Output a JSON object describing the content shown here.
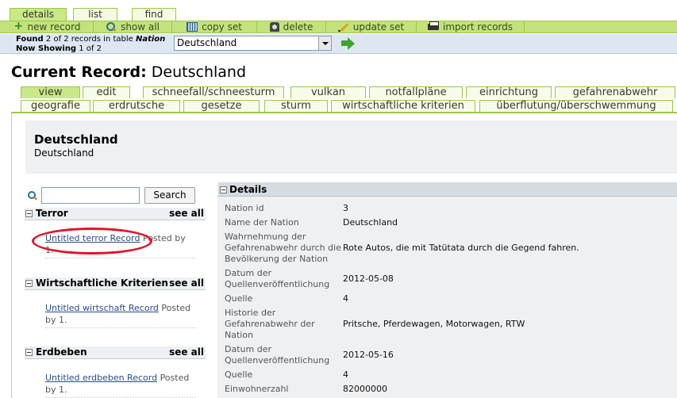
{
  "top_tabs": [
    "details",
    "list",
    "find"
  ],
  "actions": [
    {
      "label": "new record",
      "icon": "plus-icon"
    },
    {
      "label": "show all",
      "icon": "magnifier-icon"
    },
    {
      "label": "copy set",
      "icon": "spreadsheet-icon"
    },
    {
      "label": "delete",
      "icon": "trash-icon"
    },
    {
      "label": "update set",
      "icon": "pencil-icon"
    },
    {
      "label": "import records",
      "icon": "printer-icon"
    }
  ],
  "found": {
    "found_label": "Found",
    "found_count": "2",
    "of_text": "of 2 records in table",
    "table_name": "Nation",
    "now_showing_label": "Now Showing",
    "now_showing_value": "1 of 2"
  },
  "record_select": {
    "value": "Deutschland"
  },
  "heading": {
    "label": "Current Record:",
    "value": "Deutschland"
  },
  "record_tabs_row1": [
    "view",
    "edit",
    "schneefall/schneesturm",
    "vulkan",
    "notfallpläne",
    "einrichtung",
    "gefahrenabwehr"
  ],
  "record_tabs_row2": [
    "geografie",
    "erdrutsche",
    "gesetze",
    "sturm",
    "wirtschaftliche kriterien",
    "überflutung/überschwemmung"
  ],
  "record_header": {
    "title": "Deutschland",
    "subtitle": "Deutschland"
  },
  "search": {
    "button_label": "Search",
    "value": ""
  },
  "sections": [
    {
      "title": "Terror",
      "see_all": "see all",
      "item_link": "Untitled terror Record",
      "item_text_1": "Posted by",
      "item_text_2": "1."
    },
    {
      "title": "Wirtschaftliche Kriterien",
      "see_all": "see all",
      "item_link": "Untitled wirtschaft Record",
      "item_text_1": "Posted",
      "item_text_2": "by 1."
    },
    {
      "title": "Erdbeben",
      "see_all": "see all",
      "item_link": "Untitled erdbeben Record",
      "item_text_1": "Posted",
      "item_text_2": "by 1."
    }
  ],
  "details": {
    "title": "Details",
    "fields": [
      {
        "label": "Nation id",
        "value": "3"
      },
      {
        "label": "Name der Nation",
        "value": "Deutschland"
      },
      {
        "label": "Wahrnehmung der Gefahrenabwehr durch die Bevölkerung der Nation",
        "value": "Rote Autos, die mit Tatütata durch die Gegend fahren."
      },
      {
        "label": "Datum der Quellenveröffentlichung",
        "value": "2012-05-08"
      },
      {
        "label": "Quelle",
        "value": "4"
      },
      {
        "label": "Historie der Gefahrenabwehr der Nation",
        "value": "Pritsche, Pferdewagen, Motorwagen, RTW"
      },
      {
        "label": "Datum der Quellenveröffentlichung",
        "value": "2012-05-16"
      },
      {
        "label": "Quelle",
        "value": "4"
      },
      {
        "label": "Einwohnerzahl",
        "value": "82000000"
      }
    ]
  },
  "colors": {
    "tab_green": "#c9e887",
    "bar_green": "#c3e27c",
    "link_blue": "#2a4b87",
    "annotation_red": "#e0142a"
  }
}
